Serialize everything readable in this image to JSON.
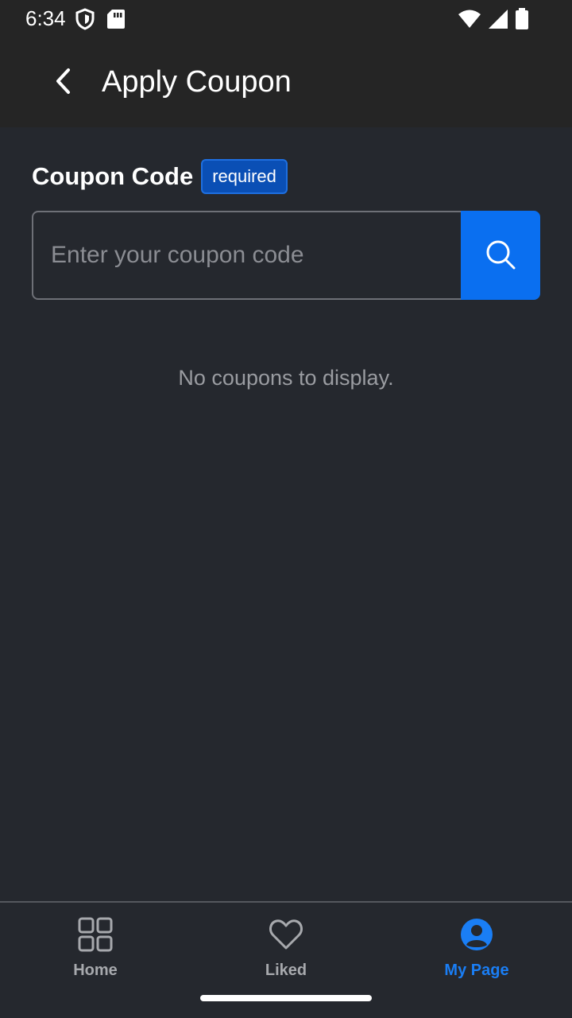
{
  "status_bar": {
    "time": "6:34",
    "left_icons": [
      "shield-icon",
      "sd-card-icon"
    ],
    "right_icons": [
      "wifi-icon",
      "cell-signal-icon",
      "battery-icon"
    ]
  },
  "app_bar": {
    "back_icon": "chevron-left-icon",
    "title": "Apply Coupon"
  },
  "coupon_form": {
    "label": "Coupon Code",
    "required_badge": "required",
    "input_value": "",
    "input_placeholder": "Enter your coupon code",
    "search_icon": "search-icon"
  },
  "empty_state": {
    "text": "No coupons to display."
  },
  "bottom_nav": {
    "items": [
      {
        "label": "Home",
        "icon": "grid-icon",
        "active": false
      },
      {
        "label": "Liked",
        "icon": "heart-icon",
        "active": false
      },
      {
        "label": "My Page",
        "icon": "person-icon",
        "active": true
      }
    ]
  },
  "colors": {
    "background": "#25282e",
    "app_bar": "#252525",
    "accent": "#0a6ff0",
    "badge_bg": "#0a4fb5",
    "active_nav": "#1a7ef5",
    "inactive_nav": "#a7a9ad",
    "muted_text": "#9a9ca1"
  }
}
